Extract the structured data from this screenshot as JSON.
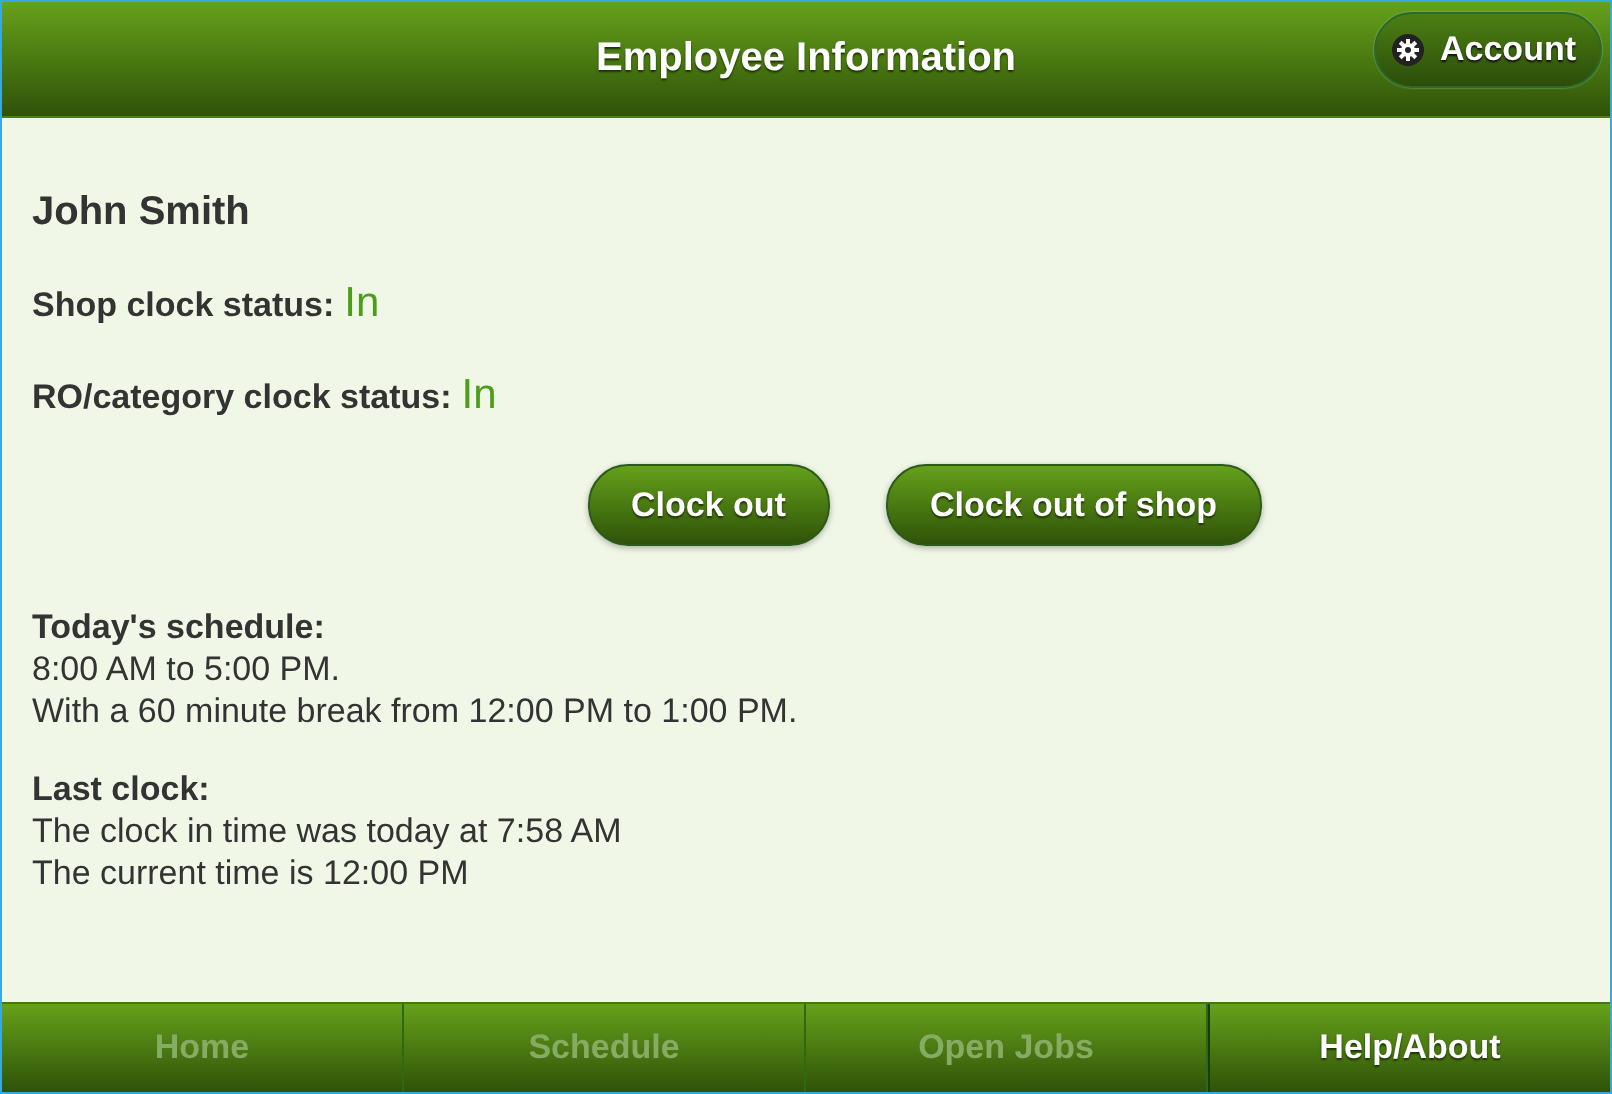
{
  "header": {
    "title": "Employee Information",
    "account_button": "Account"
  },
  "employee": {
    "name": "John Smith"
  },
  "statuses": [
    {
      "label": "Shop clock status:",
      "value": "In"
    },
    {
      "label": "RO/category clock status:",
      "value": "In"
    }
  ],
  "actions": [
    "Clock out",
    "Clock out of shop"
  ],
  "sections": [
    {
      "heading": "Today's schedule:",
      "lines": [
        "8:00 AM to 5:00 PM.",
        "With a 60 minute break from 12:00 PM to 1:00 PM."
      ]
    },
    {
      "heading": "Last clock:",
      "lines": [
        "The clock in time was today at 7:58 AM",
        "The current time is 12:00 PM"
      ]
    }
  ],
  "nav": [
    {
      "label": "Home",
      "selected": false
    },
    {
      "label": "Schedule",
      "selected": false
    },
    {
      "label": "Open Jobs",
      "selected": false
    },
    {
      "label": "Help/About",
      "selected": true
    }
  ]
}
